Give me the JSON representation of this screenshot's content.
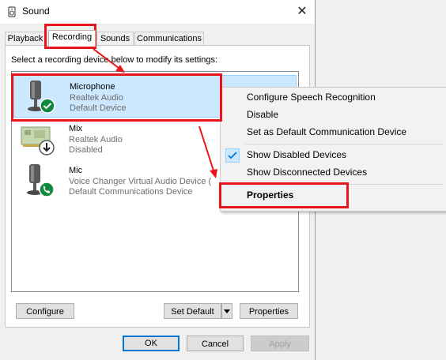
{
  "window": {
    "title": "Sound",
    "close_glyph": "✕"
  },
  "tabs": [
    {
      "label": "Playback",
      "active": false
    },
    {
      "label": "Recording",
      "active": true
    },
    {
      "label": "Sounds",
      "active": false
    },
    {
      "label": "Communications",
      "active": false
    }
  ],
  "instruction": "Select a recording device below to modify its settings:",
  "devices": [
    {
      "name": "Microphone",
      "driver": "Realtek Audio",
      "status": "Default Device",
      "icon": "microphone-icon",
      "badge": "check-badge-icon",
      "selected": true
    },
    {
      "name": "Mix",
      "driver": "Realtek Audio",
      "status": "Disabled",
      "icon": "sound-card-icon",
      "badge": "down-arrow-badge-icon",
      "selected": false
    },
    {
      "name": "Mic",
      "driver": "Voice Changer Virtual Audio Device (",
      "status": "Default Communications Device",
      "icon": "microphone-icon",
      "badge": "phone-badge-icon",
      "selected": false
    }
  ],
  "buttons": {
    "configure": "Configure",
    "set_default": "Set Default",
    "properties": "Properties",
    "ok": "OK",
    "cancel": "Cancel",
    "apply": "Apply"
  },
  "context_menu": {
    "items": [
      {
        "label": "Configure Speech Recognition"
      },
      {
        "label": "Disable"
      },
      {
        "label": "Set as Default Communication Device"
      },
      {
        "label": "Show Disabled Devices",
        "checked": true
      },
      {
        "label": "Show Disconnected Devices"
      },
      {
        "label": "Properties",
        "bold": true
      }
    ]
  },
  "colors": {
    "annotation_red": "#e8161c",
    "selection": "#cce8ff",
    "check_green": "#10893e",
    "accent": "#0078d7"
  }
}
